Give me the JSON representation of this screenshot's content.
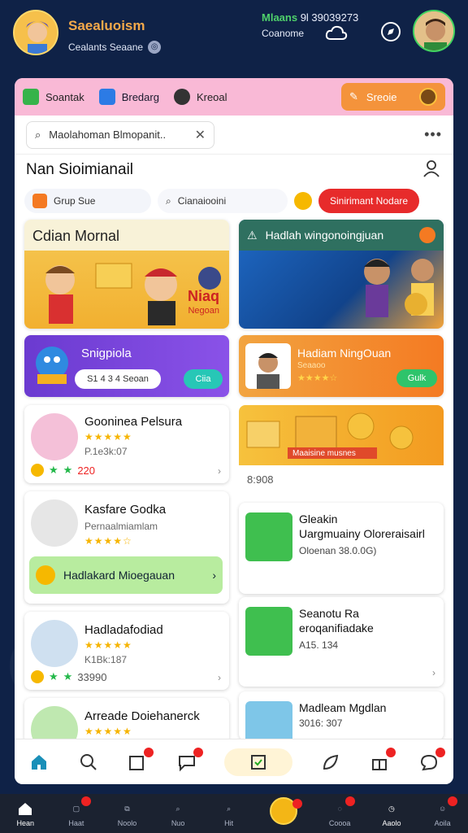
{
  "header": {
    "app_title": "Saealuoism",
    "app_sub": "Cealants Seaane",
    "top_line1_green": "Mlaans",
    "top_line1": "9l 39039273",
    "top_line2": "Coanome"
  },
  "tabs": [
    {
      "label": "Soantak"
    },
    {
      "label": "Bredarg"
    },
    {
      "label": "Kreoal"
    }
  ],
  "tab_cta": {
    "label": "Sreoie"
  },
  "search": {
    "value": "Maolahoman Blmopanit.."
  },
  "section_title": "Nan Sioimianail",
  "chips": [
    {
      "label": "Grup Sue"
    },
    {
      "label": "Cianaiooini"
    },
    {
      "label": "Sinirimant Nodare"
    }
  ],
  "cards": {
    "c1_title": "Cdian Mornal",
    "c1_badge": "Niaq",
    "c1_badge2": "Negoan",
    "c2_title": "Hadlah wingonoingjuan",
    "c3_title": "Snigpiola",
    "c3_pill": "S1 4 3 4 Seoan",
    "c3_btn": "Ciia",
    "c4_title": "Hadiam NingOuan",
    "c4_sub": "Seaaoo",
    "c4_stars": "★★★★☆",
    "c4_btn": "Gulk"
  },
  "left_list": [
    {
      "name": "Gooninea Pelsura",
      "sub": "P.1e3k:07",
      "stars": "★★★★★",
      "points": "220"
    },
    {
      "name": "Kasfare Godka",
      "sub": "Pernaalmiamlam",
      "stars": "★★★★☆",
      "bar": "Hadlakard Mioegauan"
    },
    {
      "name": "Hadladafodiad",
      "sub": "K1Bk:187",
      "stars": "★★★★★",
      "points": "33990"
    },
    {
      "name": "Arreade Doiehanerck",
      "stars": "★★★★★"
    }
  ],
  "gold_banner": {
    "text": "Maaisine musnes",
    "caption": "8:908"
  },
  "right_list": [
    {
      "t": "Gleakin",
      "s": "Uargmuainy Oloreraisairl",
      "m": "Oloenan 38.0.0G)"
    },
    {
      "t": "Seanotu Ra",
      "s": "eroqanifiadake",
      "m": "A15. 134"
    },
    {
      "t": "Madleam Mgdlan",
      "s": "",
      "m": "3016: 307"
    }
  ],
  "bottom_nav": [
    {
      "label": "Hean"
    },
    {
      "label": "Haat"
    },
    {
      "label": "Noolo"
    },
    {
      "label": "Nuo"
    },
    {
      "label": "Hit"
    },
    {
      "label": ""
    },
    {
      "label": "Coooa"
    },
    {
      "label": "Aaolo"
    },
    {
      "label": "Aoila"
    }
  ],
  "colors": {
    "accent": "#e72b2b",
    "bg": "#0f2247",
    "tabbar": "#f9b9d6",
    "cta": "#f4933b"
  }
}
